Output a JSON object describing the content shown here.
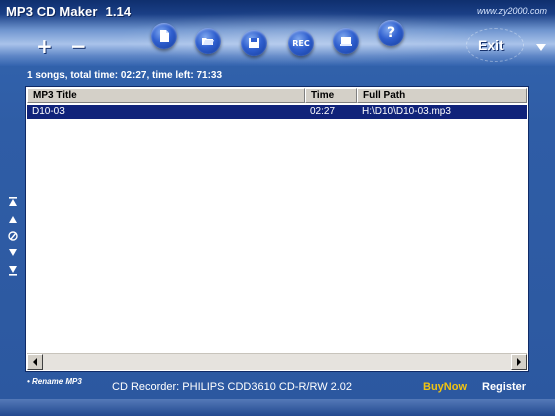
{
  "app": {
    "title": "MP3 CD Maker",
    "version": "1.14",
    "website": "www.zy2000.com"
  },
  "toolbar": {
    "add_label": "+",
    "remove_label": "−",
    "rec_label": "REC",
    "help_label": "?",
    "exit_label": "Exit",
    "icons": [
      "document-icon",
      "folder-open-icon",
      "save-icon",
      "record-icon",
      "burn-icon",
      "help-icon"
    ]
  },
  "status": {
    "summary": "1 songs, total time: 02:27, time left: 71:33"
  },
  "list": {
    "columns": [
      "MP3 Title",
      "Time",
      "Full Path"
    ],
    "rows": [
      {
        "title": "D10-03",
        "time": "02:27",
        "path": "H:\\D10\\D10-03.mp3"
      }
    ]
  },
  "footer": {
    "rename_label": "• Rename MP3",
    "recorder": "CD Recorder: PHILIPS CDD3610 CD-R/RW 2.02",
    "buy_now": "BuyNow",
    "register": "Register"
  },
  "colors": {
    "background": "#2c58a0",
    "selection": "#10237a",
    "buy_now": "#f1c410"
  }
}
